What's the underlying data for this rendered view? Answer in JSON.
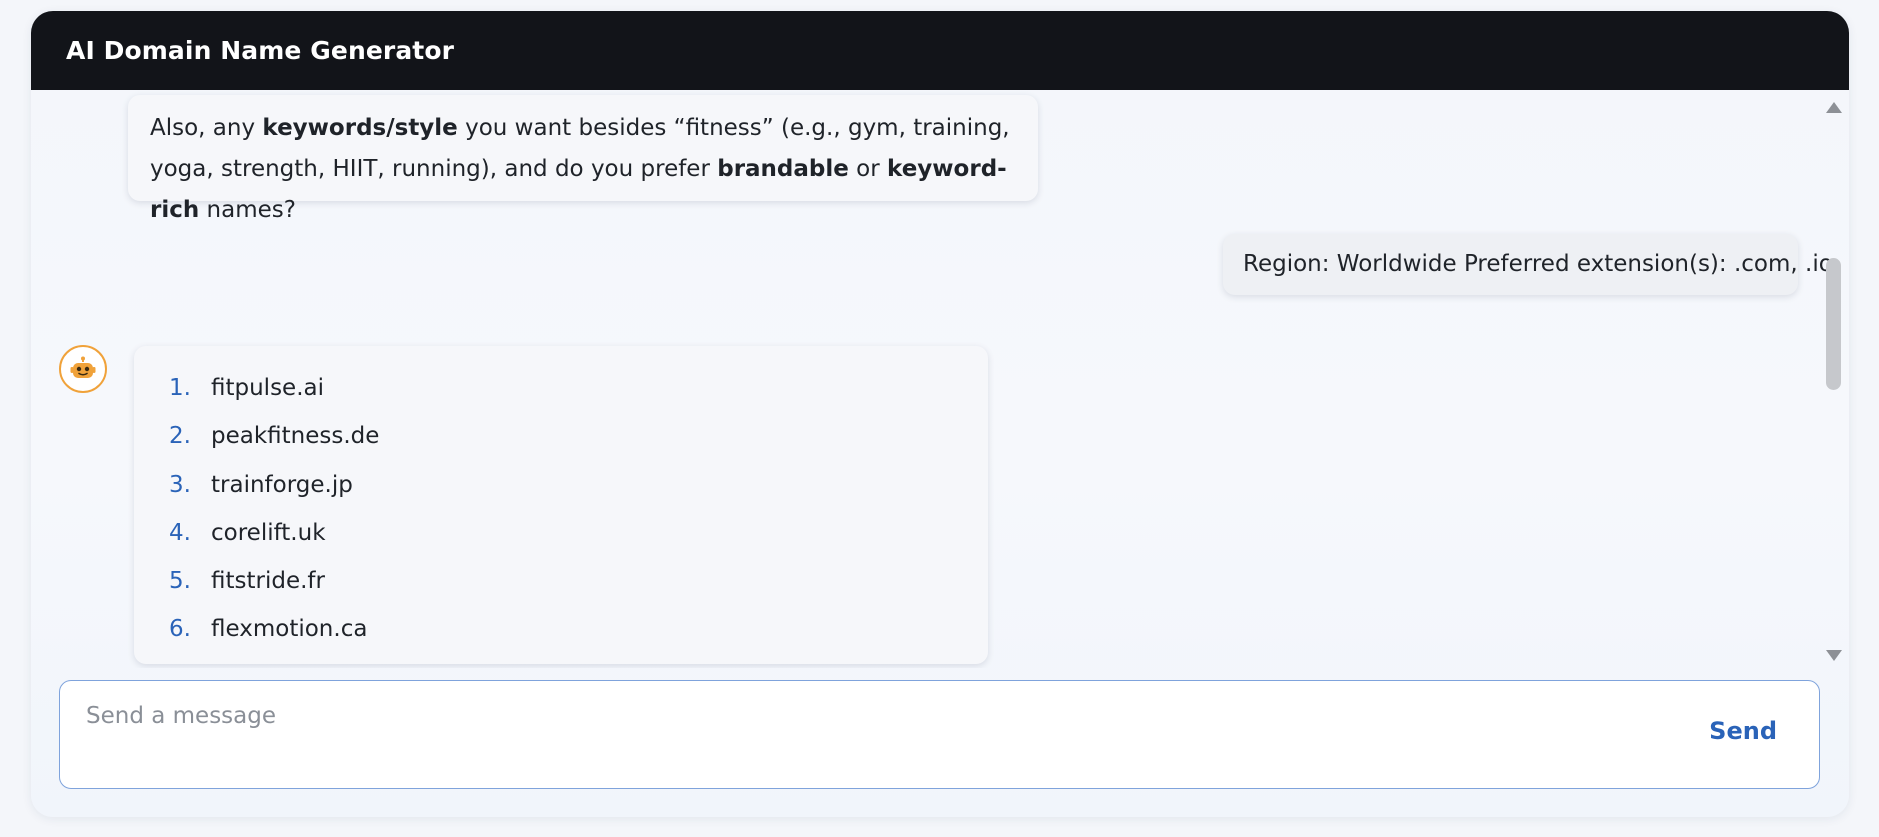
{
  "app": {
    "title": "AI Domain Name Generator"
  },
  "messages": {
    "bot_top": {
      "text_1": "Also, any ",
      "bold_1": "keywords/style",
      "text_2": " you want besides “fitness” (e.g., gym, training, yoga, strength, HIIT, running), and do you prefer ",
      "bold_2": "brandable",
      "text_3": " or ",
      "bold_3": "keyword-rich",
      "text_4": " names?"
    },
    "user": {
      "text": "Region: Worldwide Preferred extension(s): .com, .io"
    },
    "bot_list": {
      "items": [
        {
          "num": "1.",
          "name": "fitpulse.ai"
        },
        {
          "num": "2.",
          "name": "peakfitness.de"
        },
        {
          "num": "3.",
          "name": "trainforge.jp"
        },
        {
          "num": "4.",
          "name": "corelift.uk"
        },
        {
          "num": "5.",
          "name": "fitstride.fr"
        },
        {
          "num": "6.",
          "name": "flexmotion.ca"
        }
      ]
    }
  },
  "composer": {
    "placeholder": "Send a message",
    "send_label": "Send"
  },
  "icons": {
    "avatar": "robot-icon"
  },
  "colors": {
    "titlebar": "#121419",
    "accent": "#2a63b8",
    "avatar_ring": "#f0a23a"
  }
}
